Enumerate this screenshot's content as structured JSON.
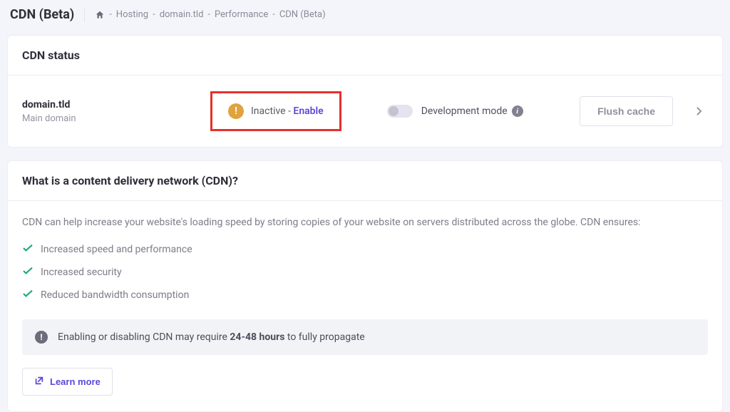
{
  "header": {
    "title": "CDN (Beta)",
    "breadcrumb": {
      "home_label": "Home",
      "items": [
        "Hosting",
        "domain.tld",
        "Performance",
        "CDN (Beta)"
      ]
    }
  },
  "status_card": {
    "title": "CDN status",
    "domain": "domain.tld",
    "domain_sub": "Main domain",
    "status_text": "Inactive",
    "status_sep": " - ",
    "enable_label": "Enable",
    "dev_mode_label": "Development mode",
    "flush_label": "Flush cache"
  },
  "info_card": {
    "title": "What is a content delivery network (CDN)?",
    "intro": "CDN can help increase your website's loading speed by storing copies of your website on servers distributed across the globe. CDN ensures:",
    "benefits": [
      "Increased speed and performance",
      "Increased security",
      "Reduced bandwidth consumption"
    ],
    "notice_pre": "Enabling or disabling CDN may require ",
    "notice_bold": "24-48 hours",
    "notice_post": " to fully propagate",
    "learn_more": "Learn more"
  }
}
